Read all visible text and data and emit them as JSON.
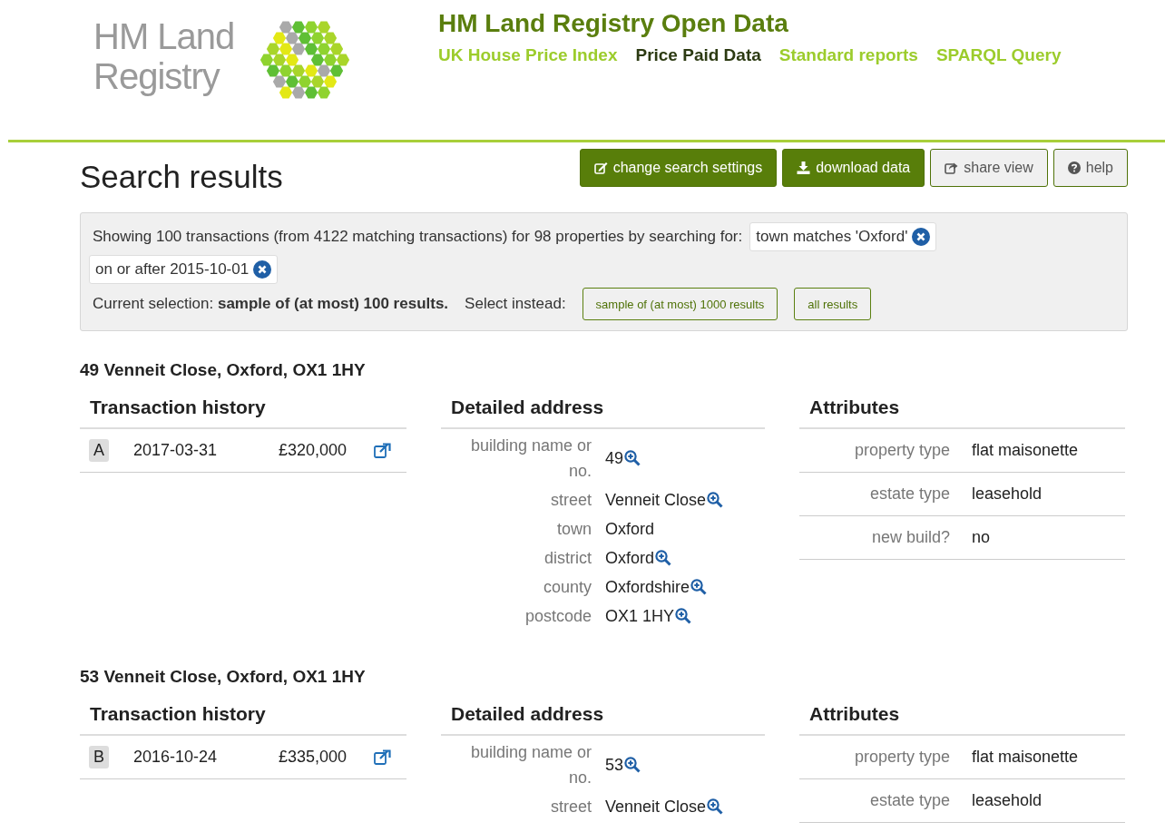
{
  "logo": {
    "line_1": "HM Land",
    "line_2": "Registry"
  },
  "site_title": "HM Land Registry Open Data",
  "nav": [
    {
      "label": "UK House Price Index",
      "selected": false
    },
    {
      "label": "Price Paid Data",
      "selected": true
    },
    {
      "label": "Standard reports",
      "selected": false
    },
    {
      "label": "SPARQL Query",
      "selected": false
    }
  ],
  "page_title": "Search results",
  "actions": [
    {
      "label": "change search settings",
      "kind": "edit",
      "primary": true
    },
    {
      "label": "download data",
      "kind": "download",
      "primary": true
    },
    {
      "label": "share view",
      "kind": "share",
      "primary": false
    },
    {
      "label": "help",
      "kind": "help",
      "primary": false
    }
  ],
  "summary": {
    "text": "Showing 100 transactions (from 4122 matching transactions) for 98 properties by searching for:",
    "filters": [
      "town matches 'Oxford'",
      "on or after 2015-10-01"
    ],
    "selection_text": "Current selection: **sample of (at most) 100 results.**",
    "select_instead": "Select instead:",
    "options": [
      "sample of (at most) 1000 results",
      "all results"
    ]
  },
  "properties": [
    {
      "address": "49 Venneit Close, Oxford, OX1 1HY",
      "history_title": "Transaction history",
      "transactions": [
        {
          "letter": "A",
          "date": "2017-03-31",
          "price": "£320,000"
        }
      ],
      "address_title": "Detailed address",
      "address_fields": [
        {
          "label": "building name or no.",
          "value": "49",
          "searchable": true
        },
        {
          "label": "street",
          "value": "Venneit Close",
          "searchable": true
        },
        {
          "label": "town",
          "value": "Oxford",
          "searchable": false
        },
        {
          "label": "district",
          "value": "Oxford",
          "searchable": true
        },
        {
          "label": "county",
          "value": "Oxfordshire",
          "searchable": true
        },
        {
          "label": "postcode",
          "value": "OX1 1HY",
          "searchable": true
        }
      ],
      "attributes_title": "Attributes",
      "attributes": [
        {
          "label": "property type",
          "value": "flat maisonette"
        },
        {
          "label": "estate type",
          "value": "leasehold"
        },
        {
          "label": "new build?",
          "value": "no"
        }
      ]
    },
    {
      "address": "53 Venneit Close, Oxford, OX1 1HY",
      "history_title": "Transaction history",
      "transactions": [
        {
          "letter": "B",
          "date": "2016-10-24",
          "price": "£335,000"
        }
      ],
      "address_title": "Detailed address",
      "address_fields": [
        {
          "label": "building name or no.",
          "value": "53",
          "searchable": true
        },
        {
          "label": "street",
          "value": "Venneit Close",
          "searchable": true
        }
      ],
      "attributes_title": "Attributes",
      "attributes": [
        {
          "label": "property type",
          "value": "flat maisonette"
        },
        {
          "label": "estate type",
          "value": "leasehold"
        }
      ]
    }
  ]
}
